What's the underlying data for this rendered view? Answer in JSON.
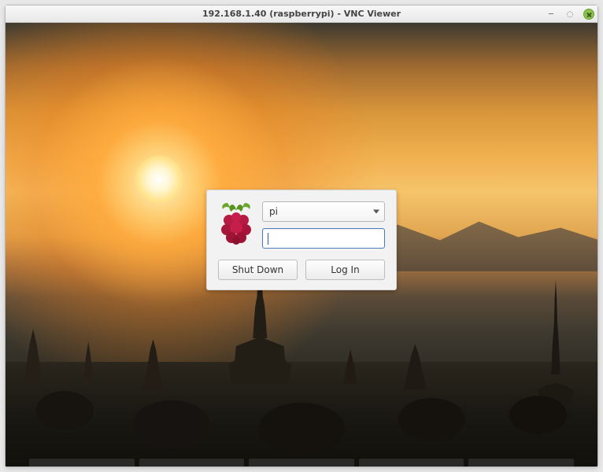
{
  "window": {
    "title": "192.168.1.40 (raspberrypi) - VNC Viewer"
  },
  "login": {
    "username_selected": "pi",
    "password_value": "",
    "shutdown_label": "Shut Down",
    "login_label": "Log In"
  },
  "icons": {
    "logo": "raspberry-pi-logo",
    "dropdown": "chevron-down-icon",
    "minimize": "minimize-icon",
    "maximize": "maximize-icon",
    "close": "close-icon"
  }
}
